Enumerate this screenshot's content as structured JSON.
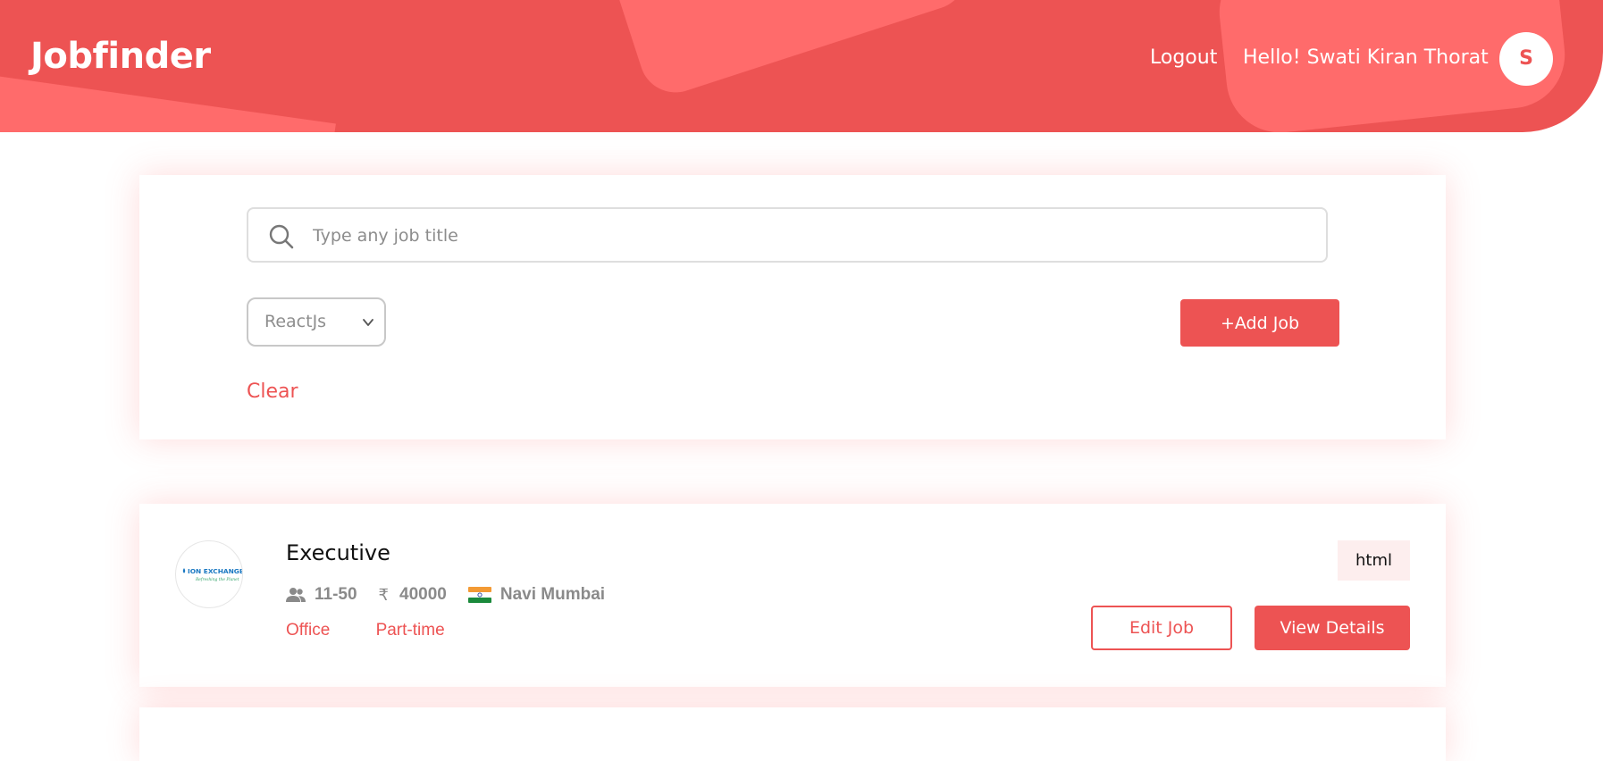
{
  "header": {
    "logo": "Jobfinder",
    "logout_label": "Logout",
    "greeting": "Hello! Swati Kiran Thorat",
    "avatar_initial": "S"
  },
  "filters": {
    "search_placeholder": "Type any job title",
    "search_value": "",
    "skill_select_value": "ReactJs",
    "add_job_label": "+Add Job",
    "clear_label": "Clear"
  },
  "jobs": [
    {
      "company_logo_text": "ION EXCHANGE",
      "company_logo_tagline": "Refreshing the Planet",
      "title": "Executive",
      "team_size": "11-50",
      "currency_symbol": "₹",
      "salary": "40000",
      "location": "Navi Mumbai",
      "work_mode": "Office",
      "job_type": "Part-time",
      "skill": "html",
      "edit_label": "Edit Job",
      "view_label": "View Details"
    }
  ],
  "colors": {
    "accent": "#ed5353",
    "accent_light": "#ff6b6b",
    "badge_bg": "#fdeeee"
  },
  "icons": {
    "search": "search-icon",
    "select": "chevron-down-icon",
    "team": "people-icon",
    "salary": "rupee-icon",
    "location": "india-flag-icon"
  }
}
